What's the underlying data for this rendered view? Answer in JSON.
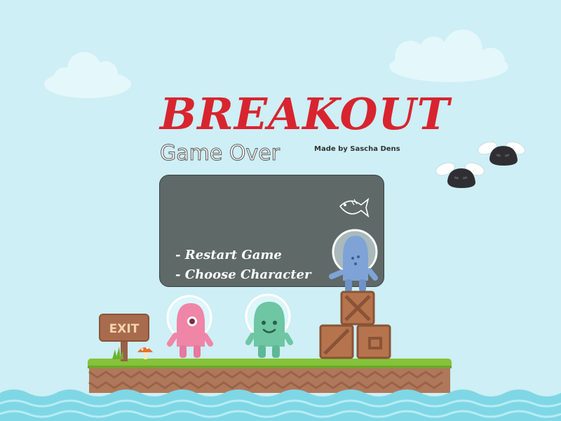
{
  "title": "BREAKOUT",
  "subtitle": "Game Over",
  "credit": "Made by Sascha Dens",
  "menu": {
    "restart_label": "- Restart Game",
    "choose_label": "- Choose Character"
  },
  "sign": {
    "label": "EXIT"
  },
  "colors": {
    "sky": "#cdeff5",
    "title": "#d8242f",
    "panel": "#5e6968",
    "grass": "#86c23a",
    "dirt": "#b0785a",
    "water": "#7fd7e6"
  },
  "icons": [
    "fish-icon",
    "cloud",
    "flying-blob-enemy",
    "pink-alien",
    "green-alien",
    "blue-alien",
    "wooden-crate",
    "mushroom",
    "grass-tuft",
    "exit-sign"
  ]
}
